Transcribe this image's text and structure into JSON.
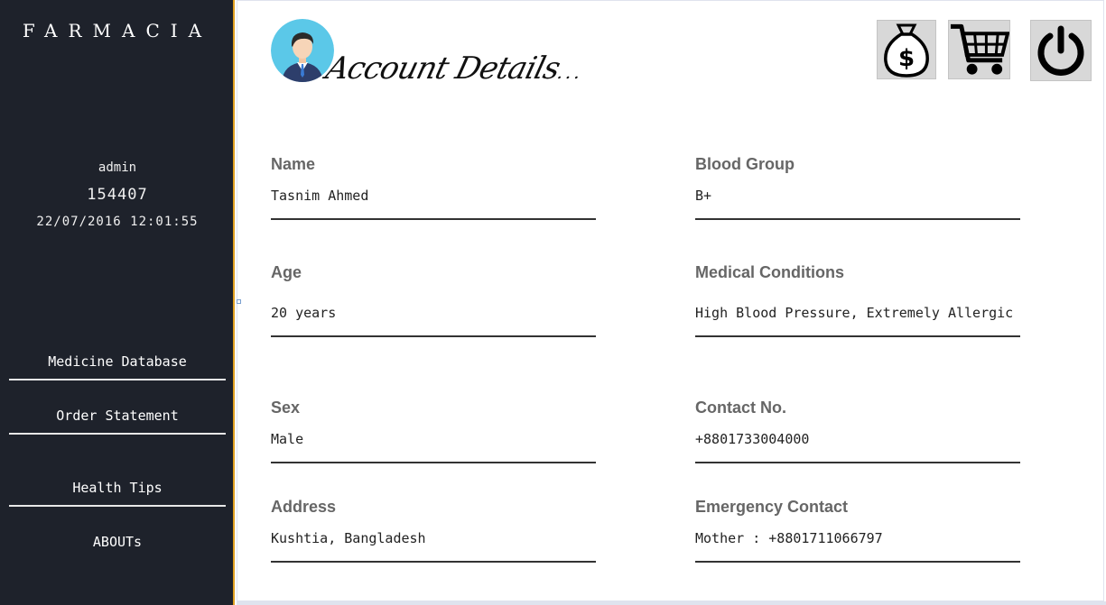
{
  "sidebar": {
    "brand": "FARMACIA",
    "user": {
      "username": "admin",
      "id": "154407",
      "datetime": "22/07/2016 12:01:55"
    },
    "nav": [
      {
        "label": "Medicine Database"
      },
      {
        "label": "Order Statement"
      },
      {
        "label": "Health Tips"
      },
      {
        "label": "ABOUTs"
      }
    ]
  },
  "header": {
    "title": "Account Details",
    "title_suffix": "...",
    "icons": [
      "avatar-icon",
      "money-bag-icon",
      "shopping-cart-icon",
      "power-icon"
    ]
  },
  "fields": {
    "name": {
      "label": "Name",
      "value": "Tasnim Ahmed"
    },
    "blood_group": {
      "label": "Blood Group",
      "value": "B+"
    },
    "age": {
      "label": "Age",
      "value": "20 years"
    },
    "medical_conditions": {
      "label": "Medical Conditions",
      "value": "High Blood Pressure, Extremely Allergic"
    },
    "sex": {
      "label": "Sex",
      "value": "Male"
    },
    "contact": {
      "label": "Contact No.",
      "value": "+8801733004000"
    },
    "address": {
      "label": "Address",
      "value": "Kushtia, Bangladesh"
    },
    "emergency_contact": {
      "label": "Emergency Contact",
      "value": "Mother : +8801711066797"
    }
  },
  "colors": {
    "sidebar_bg": "#1e222b",
    "accent_border": "#e0a020",
    "avatar_bg": "#5bc8e8"
  }
}
